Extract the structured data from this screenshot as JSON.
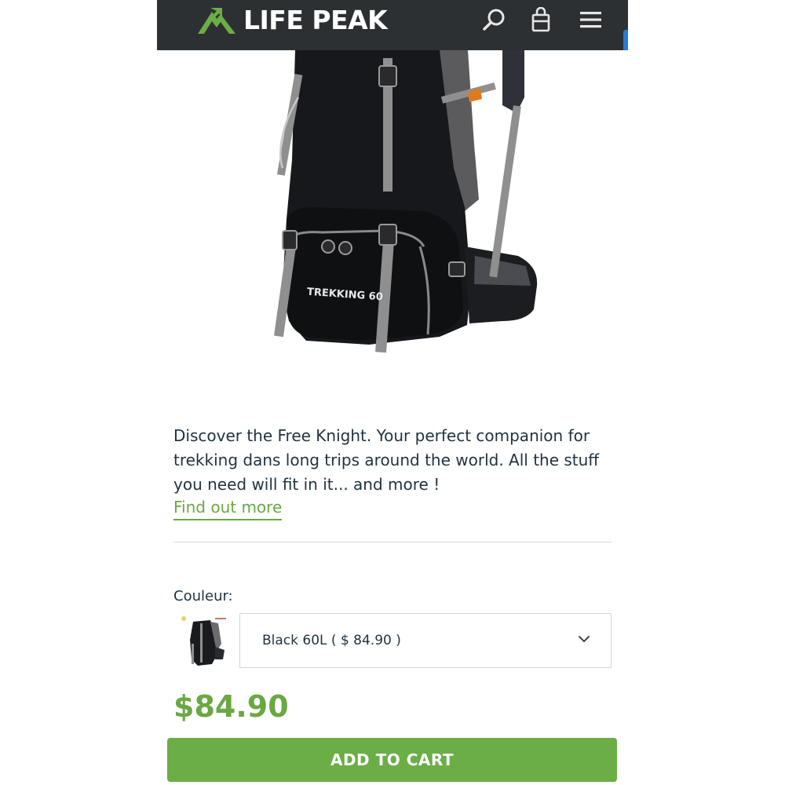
{
  "header": {
    "brand": "LIFE PEAK",
    "icons": [
      "search-icon",
      "shopping-bag-icon",
      "hamburger-menu-icon"
    ]
  },
  "product": {
    "image_label": "TREKKING 60",
    "description": "Discover the Free Knight. Your perfect companion for trekking dans long trips around the world. All the stuff you need will fit in it... and more !",
    "more_link": "Find out more",
    "color_label": "Couleur:",
    "color_selected": "Black 60L ( $ 84.90 )",
    "price": "$84.90",
    "add_to_cart": "ADD TO CART"
  },
  "colors": {
    "header_bg": "#2d3033",
    "accent_green": "#6aae45",
    "text_dark": "#1f3240"
  }
}
